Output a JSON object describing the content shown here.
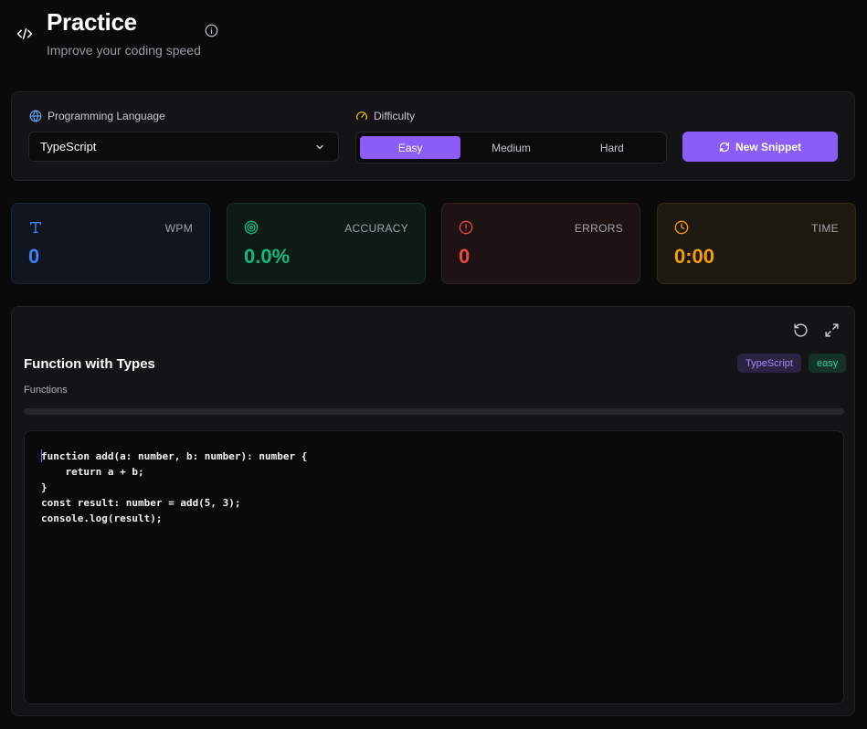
{
  "header": {
    "title": "Practice",
    "subtitle": "Improve your coding speed"
  },
  "controls": {
    "language_label": "Programming Language",
    "language_value": "TypeScript",
    "difficulty_label": "Difficulty",
    "difficulty_options": [
      "Easy",
      "Medium",
      "Hard"
    ],
    "difficulty_selected": "Easy",
    "new_snippet_label": "New Snippet"
  },
  "stats": {
    "wpm": {
      "label": "WPM",
      "value": "0"
    },
    "accuracy": {
      "label": "ACCURACY",
      "value": "0.0%"
    },
    "errors": {
      "label": "ERRORS",
      "value": "0"
    },
    "time": {
      "label": "TIME",
      "value": "0:00"
    }
  },
  "snippet": {
    "title": "Function with Types",
    "category": "Functions",
    "language_badge": "TypeScript",
    "difficulty_badge": "easy",
    "progress": 0,
    "code_lines": [
      "function add(a: number, b: number): number {",
      "    return a + b;",
      "}",
      "const result: number = add(5, 3);",
      "console.log(result);"
    ]
  },
  "colors": {
    "accent": "#8b5cf6",
    "wpm": "#3b82f6",
    "accuracy": "#10b981",
    "errors": "#ef4444",
    "time": "#f59e0b"
  },
  "icons": {
    "header": "code-icon",
    "info": "info-icon",
    "language": "globe-icon",
    "difficulty": "gauge-icon",
    "new_snippet": "refresh-icon",
    "wpm": "type-icon",
    "accuracy": "target-icon",
    "errors": "alert-circle-icon",
    "time": "clock-icon",
    "reset": "rotate-ccw-icon",
    "expand": "maximize-icon"
  }
}
